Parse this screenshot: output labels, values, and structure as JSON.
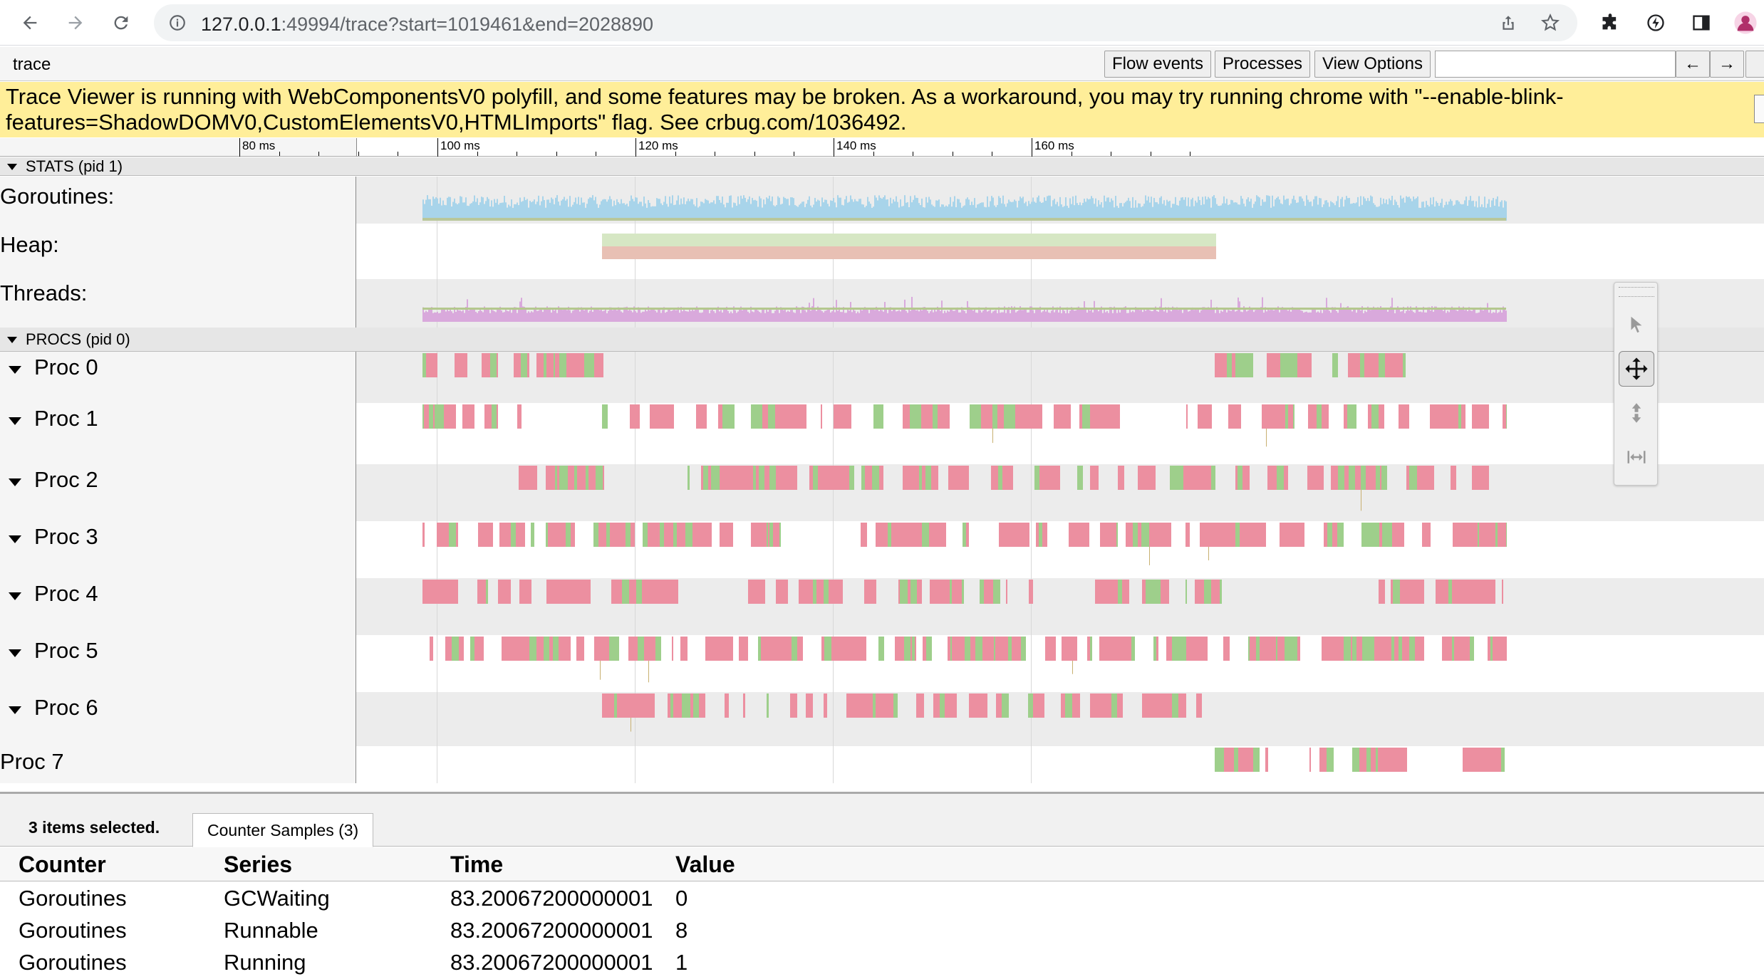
{
  "browser": {
    "url_host": "127.0.0.1",
    "url_rest": ":49994/trace?start=1019461&end=2028890"
  },
  "toolbar": {
    "title": "trace",
    "flow_events": "Flow events",
    "processes": "Processes",
    "view_options": "View Options",
    "prev": "←",
    "next": "→"
  },
  "warning": {
    "text": "Trace Viewer is running with WebComponentsV0 polyfill, and some features may be broken. As a workaround, you may try running chrome with \"--enable-blink-features=ShadowDOMV0,CustomElementsV0,HTMLImports\" flag. See crbug.com/1036492."
  },
  "ruler": {
    "ticks": [
      {
        "label": "80 ms",
        "ms": 80
      },
      {
        "label": "100 ms",
        "ms": 100
      },
      {
        "label": "120 ms",
        "ms": 120
      },
      {
        "label": "140 ms",
        "ms": 140
      },
      {
        "label": "160 ms",
        "ms": 160
      }
    ]
  },
  "stats": {
    "header": "STATS (pid 1)",
    "counters": [
      {
        "label": "Goroutines:"
      },
      {
        "label": "Heap:"
      },
      {
        "label": "Threads:"
      }
    ]
  },
  "procs": {
    "header": "PROCS (pid 0)",
    "rows": [
      {
        "label": "Proc 0",
        "expandable": true
      },
      {
        "label": "Proc 1",
        "expandable": true
      },
      {
        "label": "Proc 2",
        "expandable": true
      },
      {
        "label": "Proc 3",
        "expandable": true
      },
      {
        "label": "Proc 4",
        "expandable": true
      },
      {
        "label": "Proc 5",
        "expandable": true
      },
      {
        "label": "Proc 6",
        "expandable": true
      },
      {
        "label": "Proc 7",
        "expandable": false
      }
    ]
  },
  "colors": {
    "goroutines": "#a8d4ea",
    "heap_top": "#d6e7c4",
    "heap_bottom": "#e8c0b4",
    "threads": "#d9a9dc",
    "slice_pink": "#ec8fa0",
    "slice_green": "#9ecf8b",
    "warning_bg": "#ffee99"
  },
  "analysis": {
    "selection": "3 items selected.",
    "tab": "Counter Samples (3)",
    "columns": [
      "Counter",
      "Series",
      "Time",
      "Value"
    ],
    "rows": [
      [
        "Goroutines",
        "GCWaiting",
        "83.20067200000001",
        "0"
      ],
      [
        "Goroutines",
        "Runnable",
        "83.20067200000001",
        "8"
      ],
      [
        "Goroutines",
        "Running",
        "83.20067200000001",
        "1"
      ]
    ]
  }
}
